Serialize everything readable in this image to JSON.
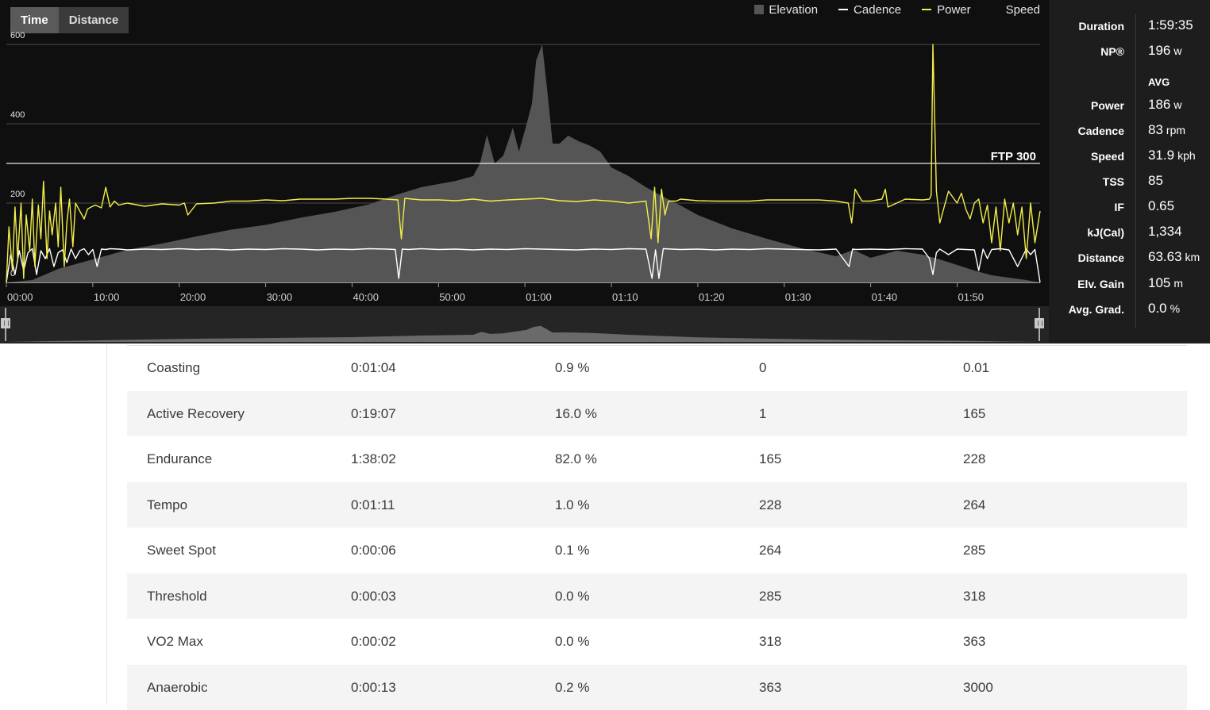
{
  "view_toggle": {
    "time_label": "Time",
    "distance_label": "Distance",
    "active": "Time"
  },
  "legend": [
    {
      "label": "Elevation",
      "kind": "box",
      "color": "#555555"
    },
    {
      "label": "Cadence",
      "kind": "line",
      "color": "#ffffff"
    },
    {
      "label": "Power",
      "kind": "line",
      "color": "#f2ee4a"
    },
    {
      "label": "Speed",
      "kind": "none",
      "color": ""
    }
  ],
  "ftp_label": "FTP 300",
  "chart_data": {
    "type": "line",
    "y_ticks": [
      "600",
      "400",
      "200",
      "0"
    ],
    "y_tick_values": [
      600,
      400,
      200,
      0
    ],
    "ylim": [
      0,
      600
    ],
    "ftp_value": 300,
    "x_ticks": [
      "00:00",
      "10:00",
      "20:00",
      "30:00",
      "40:00",
      "50:00",
      "01:00",
      "01:10",
      "01:20",
      "01:30",
      "01:40",
      "01:50"
    ],
    "x_tick_minutes": [
      0,
      10,
      20,
      30,
      40,
      50,
      60,
      70,
      80,
      90,
      100,
      110
    ],
    "xlim_minutes": [
      0,
      119.6
    ],
    "grid": true,
    "legend_position": "top-right",
    "series": [
      {
        "name": "Elevation",
        "kind": "area",
        "color": "#555555",
        "t": [
          0,
          3,
          6,
          10,
          14,
          18,
          22,
          26,
          30,
          34,
          38,
          42,
          45,
          48,
          52,
          54,
          54.8,
          55.6,
          56.5,
          57.5,
          58.6,
          59.3,
          60.1,
          60.8,
          61.3,
          62,
          62.6,
          63.2,
          64,
          65,
          66.3,
          67.5,
          68.7,
          70,
          72,
          74,
          76,
          78,
          80,
          84,
          88,
          92,
          96,
          98,
          100,
          103,
          106,
          108,
          110,
          112,
          114,
          116,
          118,
          119.6
        ],
        "v": [
          0,
          6,
          34,
          58,
          82,
          98,
          116,
          133,
          145,
          163,
          178,
          197,
          220,
          240,
          256,
          268,
          300,
          372,
          300,
          320,
          390,
          330,
          392,
          450,
          560,
          600,
          480,
          350,
          350,
          370,
          355,
          345,
          330,
          290,
          268,
          240,
          216,
          194,
          170,
          136,
          110,
          86,
          66,
          82,
          62,
          80,
          70,
          58,
          44,
          30,
          18,
          12,
          6,
          0
        ]
      },
      {
        "name": "Power",
        "kind": "line",
        "color": "#f2ee4a",
        "t": [
          0,
          0.3,
          0.7,
          1,
          1.3,
          1.7,
          2,
          2.3,
          2.7,
          3,
          3.3,
          3.7,
          4,
          4.3,
          4.7,
          5,
          5.3,
          5.7,
          6,
          6.3,
          6.7,
          7,
          7.3,
          7.7,
          8,
          8.5,
          9,
          9.4,
          9.8,
          10.3,
          11,
          11.5,
          12,
          12.5,
          13,
          14,
          16,
          18,
          20,
          20.6,
          21,
          22,
          24,
          26,
          28,
          30,
          32,
          34,
          36,
          38,
          40,
          42,
          44,
          45.3,
          45.7,
          46.1,
          47,
          48,
          50,
          52,
          54,
          56,
          58,
          60,
          62,
          64,
          66,
          68,
          70,
          72,
          74,
          74.6,
          75,
          75.4,
          75.8,
          76.2,
          76.6,
          77.5,
          78,
          80,
          82,
          84,
          86,
          88,
          90,
          92,
          94,
          96,
          97.4,
          97.8,
          98.2,
          99,
          100,
          101.3,
          101.7,
          102,
          104,
          106,
          106.8,
          107,
          107.2,
          107.6,
          108,
          109,
          110,
          110.5,
          111,
          111.5,
          112,
          112.5,
          113,
          113.5,
          114,
          114.5,
          115,
          115.5,
          116,
          116.5,
          117,
          117.5,
          118,
          118.5,
          119,
          119.6
        ],
        "v": [
          0,
          140,
          30,
          190,
          60,
          200,
          10,
          170,
          80,
          210,
          40,
          195,
          110,
          255,
          60,
          180,
          120,
          200,
          90,
          240,
          40,
          150,
          210,
          90,
          200,
          180,
          160,
          185,
          190,
          195,
          188,
          240,
          190,
          205,
          195,
          200,
          192,
          198,
          195,
          200,
          170,
          198,
          200,
          205,
          205,
          208,
          206,
          210,
          210,
          210,
          212,
          212,
          210,
          208,
          110,
          212,
          210,
          208,
          208,
          206,
          210,
          205,
          208,
          210,
          212,
          206,
          204,
          208,
          205,
          200,
          205,
          110,
          240,
          100,
          235,
          170,
          205,
          205,
          210,
          206,
          205,
          205,
          205,
          208,
          208,
          208,
          208,
          205,
          200,
          150,
          235,
          205,
          205,
          210,
          235,
          190,
          210,
          208,
          210,
          220,
          600,
          230,
          150,
          230,
          200,
          225,
          185,
          160,
          200,
          210,
          150,
          195,
          100,
          190,
          80,
          210,
          150,
          200,
          120,
          190,
          60,
          200,
          100,
          180,
          70,
          0
        ]
      },
      {
        "name": "Cadence",
        "kind": "line",
        "color": "#ffffff",
        "t": [
          0,
          0.5,
          1,
          1.5,
          2,
          2.5,
          3,
          3.5,
          4,
          4.5,
          5,
          5.5,
          6,
          6.5,
          7,
          7.5,
          8,
          8.5,
          9,
          9.5,
          10,
          10.5,
          11,
          11.5,
          12,
          13,
          14,
          16,
          18,
          20,
          22,
          24,
          26,
          28,
          30,
          32,
          34,
          36,
          38,
          40,
          42,
          44,
          45,
          45.4,
          45.8,
          46.5,
          48,
          50,
          52,
          54,
          56,
          58,
          60,
          62,
          64,
          66,
          68,
          70,
          72,
          74,
          74.7,
          75.1,
          75.5,
          76,
          77,
          78,
          80,
          82,
          84,
          86,
          88,
          90,
          92,
          94,
          96,
          97.5,
          97.9,
          98.3,
          100,
          102,
          104,
          106,
          106.8,
          107.2,
          107.6,
          108,
          109,
          110,
          111,
          112,
          112.5,
          113,
          113.5,
          114,
          115,
          116,
          117,
          118,
          118.5,
          119,
          119.6
        ],
        "v": [
          0,
          70,
          20,
          80,
          30,
          75,
          85,
          20,
          80,
          60,
          85,
          40,
          75,
          82,
          50,
          84,
          60,
          80,
          85,
          70,
          83,
          40,
          84,
          83,
          85,
          84,
          82,
          84,
          83,
          85,
          83,
          84,
          82,
          84,
          83,
          85,
          84,
          82,
          84,
          83,
          85,
          84,
          83,
          10,
          84,
          83,
          85,
          83,
          84,
          82,
          84,
          83,
          85,
          84,
          83,
          82,
          84,
          83,
          85,
          84,
          10,
          82,
          10,
          85,
          84,
          83,
          84,
          82,
          84,
          83,
          85,
          84,
          83,
          82,
          84,
          40,
          84,
          83,
          84,
          83,
          85,
          84,
          60,
          20,
          75,
          84,
          70,
          84,
          83,
          82,
          30,
          84,
          60,
          83,
          85,
          82,
          40,
          84,
          70,
          83,
          0
        ]
      }
    ],
    "overview": {
      "t": [
        0,
        10,
        20,
        30,
        40,
        48,
        54,
        55,
        56,
        57.5,
        59,
        60.2,
        61,
        61.8,
        62.5,
        63.2,
        64,
        66,
        68,
        72,
        80,
        90,
        100,
        110,
        116,
        119.6
      ],
      "v": [
        0,
        55,
        112,
        145,
        178,
        238,
        268,
        372,
        300,
        320,
        392,
        450,
        560,
        600,
        480,
        350,
        355,
        350,
        330,
        268,
        170,
        110,
        66,
        44,
        12,
        0
      ]
    }
  },
  "stats": {
    "summary": [
      {
        "label": "Duration",
        "value": "1:59:35",
        "unit": ""
      },
      {
        "label": "NP®",
        "value": "196",
        "unit": "w"
      }
    ],
    "avg_heading": "AVG",
    "avg": [
      {
        "label": "Power",
        "value": "186",
        "unit": "w"
      },
      {
        "label": "Cadence",
        "value": "83",
        "unit": "rpm"
      },
      {
        "label": "Speed",
        "value": "31.9",
        "unit": "kph"
      },
      {
        "label": "TSS",
        "value": "85",
        "unit": ""
      },
      {
        "label": "IF",
        "value": "0.65",
        "unit": ""
      },
      {
        "label": "kJ(Cal)",
        "value": "1,334",
        "unit": ""
      },
      {
        "label": "Distance",
        "value": "63.63",
        "unit": "km"
      },
      {
        "label": "Elv. Gain",
        "value": "105",
        "unit": "m"
      },
      {
        "label": "Avg. Grad.",
        "value": "0.0",
        "unit": "%"
      }
    ]
  },
  "zones": [
    {
      "name": "Coasting",
      "time": "0:01:04",
      "pct": "0.9 %",
      "low": "0",
      "high": "0.01"
    },
    {
      "name": "Active Recovery",
      "time": "0:19:07",
      "pct": "16.0 %",
      "low": "1",
      "high": "165"
    },
    {
      "name": "Endurance",
      "time": "1:38:02",
      "pct": "82.0 %",
      "low": "165",
      "high": "228"
    },
    {
      "name": "Tempo",
      "time": "0:01:11",
      "pct": "1.0 %",
      "low": "228",
      "high": "264"
    },
    {
      "name": "Sweet Spot",
      "time": "0:00:06",
      "pct": "0.1 %",
      "low": "264",
      "high": "285"
    },
    {
      "name": "Threshold",
      "time": "0:00:03",
      "pct": "0.0 %",
      "low": "285",
      "high": "318"
    },
    {
      "name": "VO2 Max",
      "time": "0:00:02",
      "pct": "0.0 %",
      "low": "318",
      "high": "363"
    },
    {
      "name": "Anaerobic",
      "time": "0:00:13",
      "pct": "0.2 %",
      "low": "363",
      "high": "3000"
    }
  ]
}
